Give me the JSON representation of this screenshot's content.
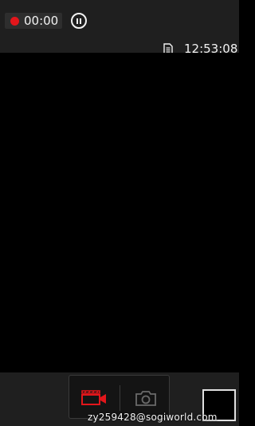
{
  "recording": {
    "elapsed": "00:00",
    "indicator_color": "#e2161b"
  },
  "status": {
    "clock": "12:53:08",
    "storage_icon": "sd-card-icon"
  },
  "controls": {
    "pause_icon": "pause-icon",
    "modes": [
      {
        "name": "video",
        "icon": "video-camera-icon",
        "active": true,
        "color": "#e2161b"
      },
      {
        "name": "photo",
        "icon": "photo-camera-icon",
        "active": false,
        "color": "#6a6a6a"
      }
    ]
  },
  "watermark": {
    "text": "zy259428@sogiworld.com"
  }
}
